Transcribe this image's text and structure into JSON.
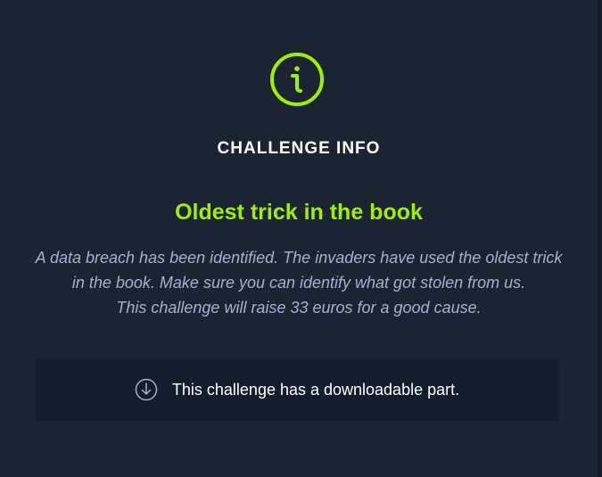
{
  "colors": {
    "background": "#1c2332",
    "accent": "#9fef00",
    "muted_text": "#a4b1cd",
    "panel": "#141d2b"
  },
  "header": {
    "icon": "info-circle-icon",
    "title": "CHALLENGE INFO"
  },
  "challenge": {
    "name": "Oldest trick in the book",
    "description_lines": [
      "A data breach has been identified. The invaders have used the oldest trick",
      "in the book. Make sure you can identify what got stolen from us.",
      "This challenge will raise 33 euros for a good cause."
    ]
  },
  "download_notice": {
    "icon": "download-circle-icon",
    "text": "This challenge has a downloadable part."
  }
}
